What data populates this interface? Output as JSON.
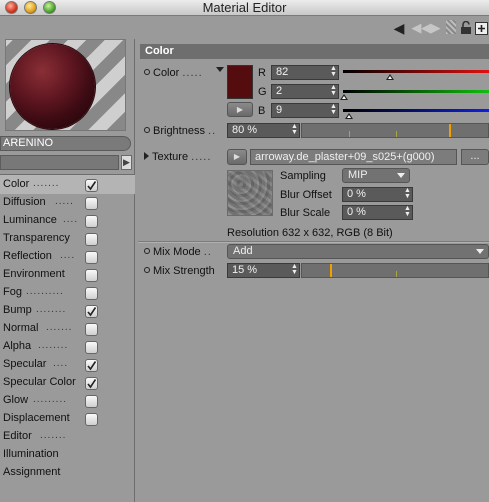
{
  "window": {
    "title": "Material Editor"
  },
  "toolbar": {
    "icons": [
      "back-arrow-icon",
      "nav-arrows-icon",
      "grip-icon",
      "lock-icon",
      "new-window-icon"
    ],
    "back_glyph": "◀",
    "nav_glyph": "◀ ◀ ▶",
    "lock_glyph": "🔓",
    "new_glyph": "⊞"
  },
  "material": {
    "name": "ARENINO",
    "preview_color": "#540c0e"
  },
  "channels": [
    {
      "label": "Color",
      "dots": ".......",
      "checkbox": true,
      "checked": true,
      "selected": true
    },
    {
      "label": "Diffusion",
      "dots": ".....",
      "checkbox": true,
      "checked": false
    },
    {
      "label": "Luminance",
      "dots": "....",
      "checkbox": true,
      "checked": false
    },
    {
      "label": "Transparency",
      "dots": "",
      "checkbox": true,
      "checked": false
    },
    {
      "label": "Reflection",
      "dots": "....",
      "checkbox": true,
      "checked": false
    },
    {
      "label": "Environment",
      "dots": "",
      "checkbox": true,
      "checked": false
    },
    {
      "label": "Fog",
      "dots": "..........",
      "checkbox": true,
      "checked": false
    },
    {
      "label": "Bump",
      "dots": "........",
      "checkbox": true,
      "checked": true
    },
    {
      "label": "Normal",
      "dots": ".......",
      "checkbox": true,
      "checked": false
    },
    {
      "label": "Alpha",
      "dots": "........",
      "checkbox": true,
      "checked": false
    },
    {
      "label": "Specular",
      "dots": "....",
      "checkbox": true,
      "checked": true
    },
    {
      "label": "Specular Color",
      "dots": "",
      "checkbox": true,
      "checked": true
    },
    {
      "label": "Glow",
      "dots": ".........",
      "checkbox": true,
      "checked": false
    },
    {
      "label": "Displacement",
      "dots": "",
      "checkbox": true,
      "checked": false
    },
    {
      "label": "Editor",
      "dots": ".......",
      "checkbox": false
    },
    {
      "label": "Illumination",
      "dots": "",
      "checkbox": false
    },
    {
      "label": "Assignment",
      "dots": "",
      "checkbox": false
    }
  ],
  "section": {
    "title": "Color"
  },
  "color": {
    "label": "Color",
    "dots": ".....",
    "swatch": "#540c0e",
    "r_label": "R",
    "r_value": "82",
    "g_label": "G",
    "g_value": "2",
    "b_label": "B",
    "b_value": "9",
    "r_fraction": 0.32,
    "g_fraction": 0.01,
    "b_fraction": 0.04,
    "pick_glyph": "▶"
  },
  "brightness": {
    "label": "Brightness",
    "dots": "..",
    "value": "80 %",
    "fraction": 0.8
  },
  "texture": {
    "label": "Texture",
    "dots": ".....",
    "button_glyph": "▶",
    "filename": "arroway.de_plaster+09_s025+(g000)",
    "more_label": "...",
    "sampling_label": "Sampling",
    "sampling_value": "MIP",
    "blur_offset_label": "Blur Offset",
    "blur_offset_value": "0 %",
    "blur_scale_label": "Blur Scale",
    "blur_scale_value": "0 %",
    "resolution": "Resolution 632 x 632, RGB (8 Bit)"
  },
  "mix_mode": {
    "label": "Mix Mode",
    "dots": "..",
    "value": "Add"
  },
  "mix_strength": {
    "label": "Mix Strength",
    "value": "15 %",
    "fraction": 0.15
  },
  "colors": {
    "header_bg": "#6e6e6e",
    "slider_handle": "#f0a000",
    "red": "#e01010",
    "green": "#10c010",
    "blue": "#1020e0"
  }
}
